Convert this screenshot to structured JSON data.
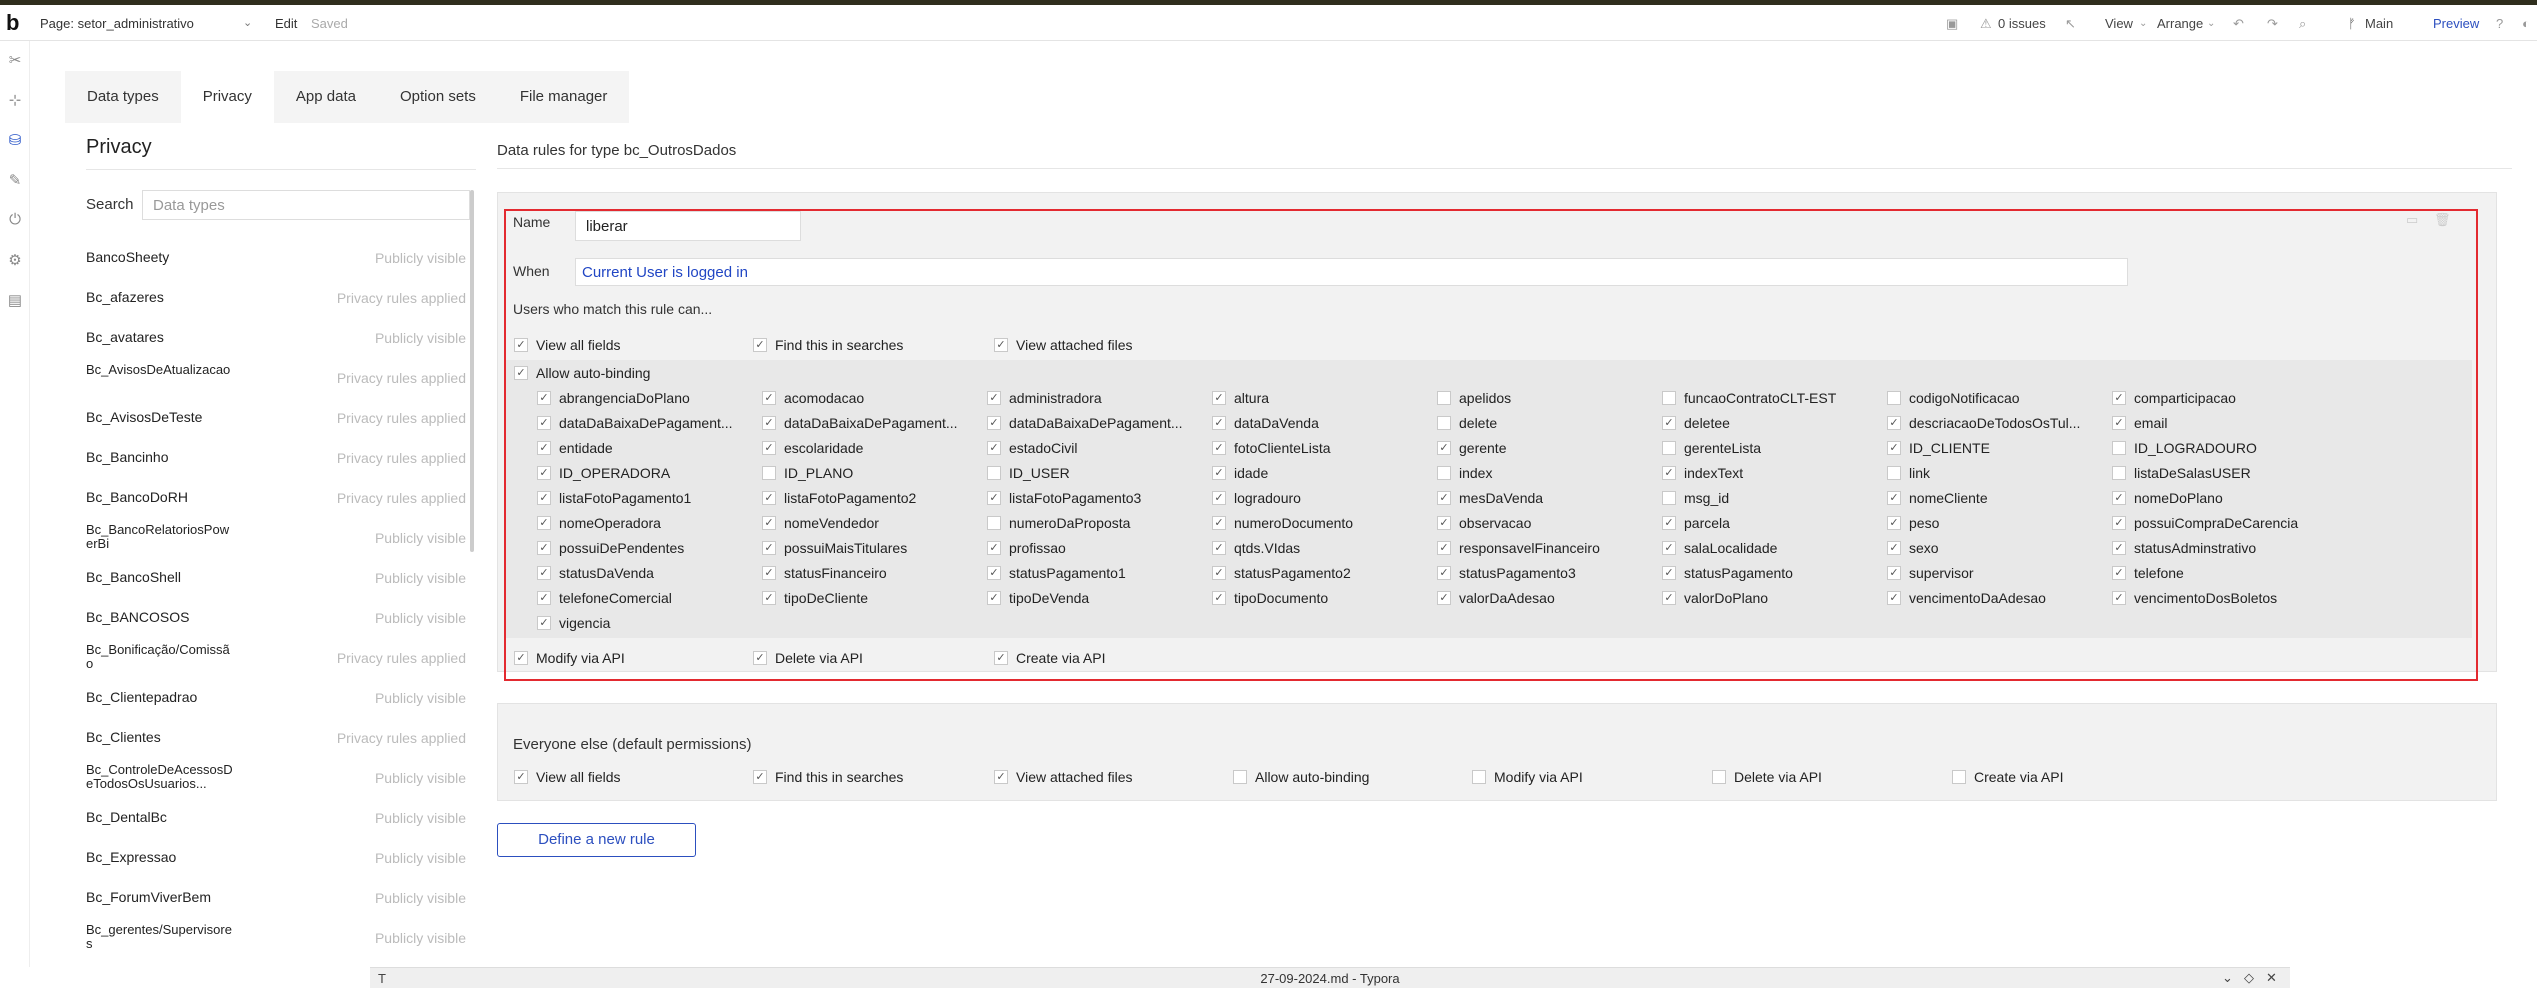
{
  "topbar": {
    "logo": "b",
    "page_select": "Page: setor_administrativo",
    "edit": "Edit",
    "saved": "Saved",
    "issues": "0 issues",
    "view": "View",
    "arrange": "Arrange",
    "main": "Main",
    "preview": "Preview"
  },
  "tabs": [
    "Data types",
    "Privacy",
    "App data",
    "Option sets",
    "File manager"
  ],
  "privacy": {
    "title": "Privacy",
    "search_label": "Search",
    "search_placeholder": "Data types",
    "types": [
      {
        "name": "BancoSheety",
        "status": "Publicly visible"
      },
      {
        "name": "Bc_afazeres",
        "status": "Privacy rules applied"
      },
      {
        "name": "Bc_avatares",
        "status": "Publicly visible"
      },
      {
        "name": "Bc_AvisosDeAtualizacao",
        "status": "Privacy rules applied"
      },
      {
        "name": "Bc_AvisosDeTeste",
        "status": "Privacy rules applied"
      },
      {
        "name": "Bc_Bancinho",
        "status": "Privacy rules applied"
      },
      {
        "name": "Bc_BancoDoRH",
        "status": "Privacy rules applied"
      },
      {
        "name": "Bc_BancoRelatoriosPowerBi",
        "status": "Publicly visible"
      },
      {
        "name": "Bc_BancoShell",
        "status": "Publicly visible"
      },
      {
        "name": "Bc_BANCOSOS",
        "status": "Publicly visible"
      },
      {
        "name": "Bc_Bonificação/Comissão",
        "status": "Privacy rules applied"
      },
      {
        "name": "Bc_Clientepadrao",
        "status": "Publicly visible"
      },
      {
        "name": "Bc_Clientes",
        "status": "Privacy rules applied"
      },
      {
        "name": "Bc_ControleDeAcessosDeTodosOsUsuarios...",
        "status": "Publicly visible"
      },
      {
        "name": "Bc_DentalBc",
        "status": "Publicly visible"
      },
      {
        "name": "Bc_Expressao",
        "status": "Publicly visible"
      },
      {
        "name": "Bc_ForumViverBem",
        "status": "Publicly visible"
      },
      {
        "name": "Bc_gerentes/Supervisores",
        "status": "Publicly visible"
      }
    ]
  },
  "rules": {
    "title": "Data rules for type bc_OutrosDados",
    "name_label": "Name",
    "name_value": "liberar",
    "when_label": "When",
    "when_value": "Current User is logged in",
    "users_match": "Users who match this rule can...",
    "top_perms": [
      {
        "label": "View all fields",
        "checked": true
      },
      {
        "label": "Find this in searches",
        "checked": true
      },
      {
        "label": "View attached files",
        "checked": true
      }
    ],
    "autobinding_label": "Allow auto-binding",
    "autobinding_checked": true,
    "fields": [
      {
        "label": "abrangenciaDoPlano",
        "checked": true
      },
      {
        "label": "acomodacao",
        "checked": true
      },
      {
        "label": "administradora",
        "checked": true
      },
      {
        "label": "altura",
        "checked": true
      },
      {
        "label": "apelidos",
        "checked": false
      },
      {
        "label": "funcaoContratoCLT-EST",
        "checked": false
      },
      {
        "label": "codigoNotificacao",
        "checked": false
      },
      {
        "label": "comparticipacao",
        "checked": true
      },
      {
        "label": "dataDaBaixaDePagament...",
        "checked": true
      },
      {
        "label": "dataDaBaixaDePagament...",
        "checked": true
      },
      {
        "label": "dataDaBaixaDePagament...",
        "checked": true
      },
      {
        "label": "dataDaVenda",
        "checked": true
      },
      {
        "label": "delete",
        "checked": false
      },
      {
        "label": "deletee",
        "checked": true
      },
      {
        "label": "descriacaoDeTodosOsTul...",
        "checked": true
      },
      {
        "label": "email",
        "checked": true
      },
      {
        "label": "entidade",
        "checked": true
      },
      {
        "label": "escolaridade",
        "checked": true
      },
      {
        "label": "estadoCivil",
        "checked": true
      },
      {
        "label": "fotoClienteLista",
        "checked": true
      },
      {
        "label": "gerente",
        "checked": true
      },
      {
        "label": "gerenteLista",
        "checked": false
      },
      {
        "label": "ID_CLIENTE",
        "checked": true
      },
      {
        "label": "ID_LOGRADOURO",
        "checked": false
      },
      {
        "label": "ID_OPERADORA",
        "checked": true
      },
      {
        "label": "ID_PLANO",
        "checked": false
      },
      {
        "label": "ID_USER",
        "checked": false
      },
      {
        "label": "idade",
        "checked": true
      },
      {
        "label": "index",
        "checked": false
      },
      {
        "label": "indexText",
        "checked": true
      },
      {
        "label": "link",
        "checked": false
      },
      {
        "label": "listaDeSalasUSER",
        "checked": false
      },
      {
        "label": "listaFotoPagamento1",
        "checked": true
      },
      {
        "label": "listaFotoPagamento2",
        "checked": true
      },
      {
        "label": "listaFotoPagamento3",
        "checked": true
      },
      {
        "label": "logradouro",
        "checked": true
      },
      {
        "label": "mesDaVenda",
        "checked": true
      },
      {
        "label": "msg_id",
        "checked": false
      },
      {
        "label": "nomeCliente",
        "checked": true
      },
      {
        "label": "nomeDoPlano",
        "checked": true
      },
      {
        "label": "nomeOperadora",
        "checked": true
      },
      {
        "label": "nomeVendedor",
        "checked": true
      },
      {
        "label": "numeroDaProposta",
        "checked": false
      },
      {
        "label": "numeroDocumento",
        "checked": true
      },
      {
        "label": "observacao",
        "checked": true
      },
      {
        "label": "parcela",
        "checked": true
      },
      {
        "label": "peso",
        "checked": true
      },
      {
        "label": "possuiCompraDeCarencia",
        "checked": true
      },
      {
        "label": "possuiDePendentes",
        "checked": true
      },
      {
        "label": "possuiMaisTitulares",
        "checked": true
      },
      {
        "label": "profissao",
        "checked": true
      },
      {
        "label": "qtds.VIdas",
        "checked": true
      },
      {
        "label": "responsavelFinanceiro",
        "checked": true
      },
      {
        "label": "salaLocalidade",
        "checked": true
      },
      {
        "label": "sexo",
        "checked": true
      },
      {
        "label": "statusAdminstrativo",
        "checked": true
      },
      {
        "label": "statusDaVenda",
        "checked": true
      },
      {
        "label": "statusFinanceiro",
        "checked": true
      },
      {
        "label": "statusPagamento1",
        "checked": true
      },
      {
        "label": "statusPagamento2",
        "checked": true
      },
      {
        "label": "statusPagamento3",
        "checked": true
      },
      {
        "label": "statusPagamento",
        "checked": true
      },
      {
        "label": "supervisor",
        "checked": true
      },
      {
        "label": "telefone",
        "checked": true
      },
      {
        "label": "telefoneComercial",
        "checked": true
      },
      {
        "label": "tipoDeCliente",
        "checked": true
      },
      {
        "label": "tipoDeVenda",
        "checked": true
      },
      {
        "label": "tipoDocumento",
        "checked": true
      },
      {
        "label": "valorDaAdesao",
        "checked": true
      },
      {
        "label": "valorDoPlano",
        "checked": true
      },
      {
        "label": "vencimentoDaAdesao",
        "checked": true
      },
      {
        "label": "vencimentoDosBoletos",
        "checked": true
      },
      {
        "label": "vigencia",
        "checked": true
      }
    ],
    "bottom_perms": [
      {
        "label": "Modify via API",
        "checked": true
      },
      {
        "label": "Delete via API",
        "checked": true
      },
      {
        "label": "Create via API",
        "checked": true
      }
    ]
  },
  "everyone": {
    "title": "Everyone else (default permissions)",
    "perms": [
      {
        "label": "View all fields",
        "checked": true
      },
      {
        "label": "Find this in searches",
        "checked": true
      },
      {
        "label": "View attached files",
        "checked": true
      },
      {
        "label": "Allow auto-binding",
        "checked": false
      },
      {
        "label": "Modify via API",
        "checked": false
      },
      {
        "label": "Delete via API",
        "checked": false
      },
      {
        "label": "Create via API",
        "checked": false
      }
    ]
  },
  "define_button": "Define a new rule",
  "footer": {
    "title": "27-09-2024.md - Typora",
    "left_icon": "T"
  },
  "colors": {
    "accent": "#2c4fbf",
    "highlight": "#e32a30",
    "link": "#2146c4"
  }
}
